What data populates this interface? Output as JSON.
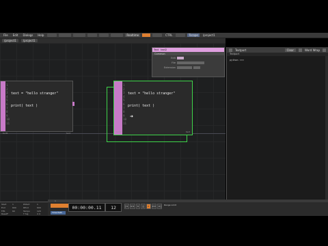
{
  "menubar": {
    "items": [
      "File",
      "Edit",
      "Dialogs",
      "Help",
      "",
      "",
      "",
      "",
      "",
      "",
      "",
      "",
      "",
      "Realtime",
      "",
      "",
      "CTRL",
      "",
      "Tscope"
    ],
    "extra": "/project1"
  },
  "pathbar": {
    "items": [
      "/project1",
      "",
      "",
      "/project1"
    ]
  },
  "dat1": {
    "lines": [
      "1",
      "2",
      "3",
      "4",
      "5",
      "6",
      "7",
      "8",
      "9",
      "10",
      "11"
    ],
    "code_line1": "text = \"hello stranger\"",
    "code_line2": "print( text )",
    "footer_left": "text1",
    "footer_right": "text"
  },
  "dat2": {
    "lines": [
      "1",
      "2",
      "3",
      "4",
      "5",
      "6",
      "7",
      "8",
      "9",
      "10",
      "11"
    ],
    "code_line1": "text = \"hello stranger\"",
    "code_line2": "print( text )",
    "footer_left": "text2",
    "footer_right": "text"
  },
  "param": {
    "tab1": "Text",
    "tab2": "text2",
    "sub": "Common",
    "rows": [
      {
        "label": "Edit"
      },
      {
        "label": "File"
      },
      {
        "label": "Extension"
      }
    ]
  },
  "textport": {
    "title": "Textport",
    "btn1": "Clear",
    "btn2": "Word Wrap",
    "sub": "Textport",
    "output": "python >>>"
  },
  "timeline": {
    "timecode": "00:00:00.11",
    "frame": "12",
    "transport": [
      "|<",
      "<<",
      "<",
      "||",
      ">",
      ">>",
      ">|"
    ],
    "ruler": [
      "1",
      "",
      "",
      "",
      "",
      "",
      "",
      "",
      "",
      "",
      "",
      "",
      "",
      "",
      "",
      "",
      "",
      ""
    ],
    "left": {
      "start_label": "Start",
      "start_val": "1",
      "end_label": "End",
      "end_val": "600",
      "rstart_label": "RStart",
      "rstart_val": "1",
      "rend_label": "REnd",
      "rend_val": "600",
      "fps_label": "FPS",
      "fps_val": "60",
      "tempo_label": "Tempo",
      "tempo_val": "120",
      "resetf_label": "ResetF",
      "tsig_label": "T Sig",
      "tsig_val": "4 4"
    },
    "range_label": "Range Limit",
    "bottom_label": "Time Path"
  },
  "colors": {
    "accent": "#e08030",
    "text_dat": "#c87ac8",
    "selection": "#3fd64a"
  }
}
